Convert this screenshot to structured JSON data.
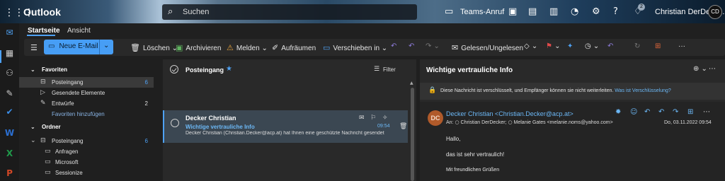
{
  "app": {
    "title": "Outlook",
    "grid_icon": "app-launcher-icon",
    "search_placeholder": "Suchen",
    "teams_call": "Teams-Anruf",
    "user_name": "Christian DerDeck...",
    "avatar_initials": "CD",
    "notification_badge": "2"
  },
  "tabs": {
    "home": "Startseite",
    "view": "Ansicht"
  },
  "ribbon": {
    "new_mail": "Neue E-Mail",
    "delete": "Löschen",
    "archive": "Archivieren",
    "report": "Melden",
    "sweep": "Aufräumen",
    "move_to": "Verschieben in",
    "read_unread": "Gelesen/Ungelesen",
    "more": "···"
  },
  "folders": {
    "favorites_header": "Favoriten",
    "favorites": [
      {
        "label": "Posteingang",
        "count": "6"
      },
      {
        "label": "Gesendete Elemente",
        "count": ""
      },
      {
        "label": "Entwürfe",
        "count": "2"
      }
    ],
    "add_favorites": "Favoriten hinzufügen",
    "folders_header": "Ordner",
    "folders": [
      {
        "label": "Posteingang",
        "count": "6"
      },
      {
        "label": "Anfragen",
        "count": ""
      },
      {
        "label": "Microsoft",
        "count": ""
      },
      {
        "label": "Sessionize",
        "count": ""
      }
    ]
  },
  "message_list": {
    "title": "Posteingang",
    "filter": "Filter",
    "messages": [
      {
        "sender": "Decker Christian",
        "subject": "Wichtige vertrauliche Info",
        "time": "09:54",
        "preview": "Decker Christian (Christian.Decker@acp.at) hat Ihnen eine geschützte Nachricht gesendet"
      }
    ]
  },
  "reading": {
    "subject": "Wichtige vertrauliche Info",
    "encryption_notice": "Diese Nachricht ist verschlüsselt, und Empfänger können sie nicht weiterleiten.",
    "encryption_link": "Was ist Verschlüsselung?",
    "avatar": "DC",
    "from": "Decker Christian <Christian.Decker@acp.at>",
    "to_label": "An:",
    "to_1": "Christian DerDecker;",
    "to_2": "Melanie Gates <melanie.noms@yahoo.com>",
    "date": "Do, 03.11.2022 09:54",
    "body": [
      "Hallo,",
      "das ist sehr vertraulich!",
      "Mit freundlichen Grüßen"
    ]
  },
  "colors": {
    "accent": "#479ef5",
    "link": "#6cb8f6",
    "avatar": "#b05a2a"
  }
}
